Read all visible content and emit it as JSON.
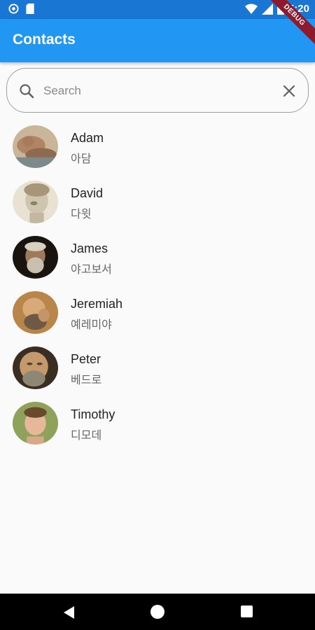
{
  "status_bar": {
    "time": "5:20",
    "icons": [
      "circle-notification-icon",
      "sd-card-icon",
      "wifi-icon",
      "signal-icon",
      "battery-icon"
    ]
  },
  "app_bar": {
    "title": "Contacts",
    "color": "#2196f3",
    "debug_banner": "DEBUG"
  },
  "search": {
    "placeholder": "Search",
    "value": "",
    "icon": "search-icon",
    "clear_icon": "close-icon"
  },
  "contacts": [
    {
      "name": "Adam",
      "korean": "아담"
    },
    {
      "name": "David",
      "korean": "다윗"
    },
    {
      "name": "James",
      "korean": "야고보서"
    },
    {
      "name": "Jeremiah",
      "korean": "예레미야"
    },
    {
      "name": "Peter",
      "korean": "베드로"
    },
    {
      "name": "Timothy",
      "korean": "디모데"
    }
  ],
  "nav_bar": {
    "buttons": [
      "back-icon",
      "home-icon",
      "recent-apps-icon"
    ]
  }
}
